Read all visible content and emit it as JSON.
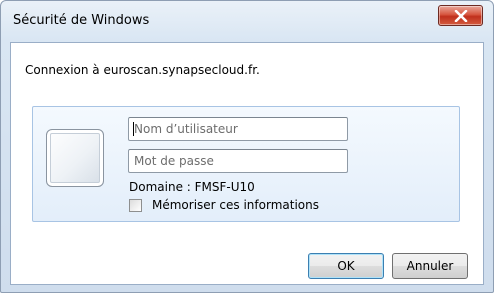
{
  "window": {
    "title": "Sécurité de Windows",
    "close_icon": "close-x-icon"
  },
  "message": "Connexion à euroscan.synapsecloud.fr.",
  "credentials": {
    "user_tile_icon": "user-tile-icon",
    "username": {
      "value": "",
      "placeholder": "Nom d’utilisateur"
    },
    "password": {
      "value": "",
      "placeholder": "Mot de passe"
    },
    "domain_text": "Domaine : FMSF-U10",
    "remember": {
      "label": "Mémoriser ces informations",
      "checked": false
    }
  },
  "buttons": {
    "ok": "OK",
    "cancel": "Annuler"
  },
  "colors": {
    "close_button": "#c0301d",
    "panel_background": "#e3eefa",
    "panel_border": "#a8c4e4",
    "default_button_border": "#3c7fb1"
  }
}
